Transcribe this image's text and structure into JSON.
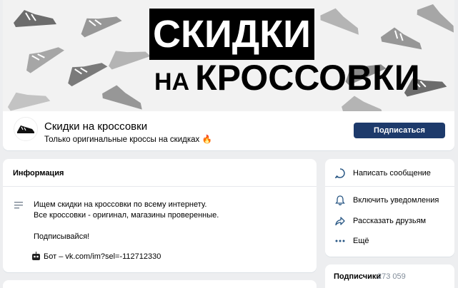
{
  "cover": {
    "line1": "СКИДКИ",
    "line2_small": "НА",
    "line2_big": "КРОССОВКИ"
  },
  "profile": {
    "name": "Скидки на кроссовки",
    "status": "Только оригинальные кроссы на скидках 🔥",
    "subscribe_label": "Подписаться"
  },
  "info": {
    "header": "Информация",
    "lines": [
      "Ищем скидки на кроссовки по всему интернету.",
      "Все кроссовки - оригинал, магазины проверенные.",
      "",
      "Подписывайся!"
    ],
    "bot": "Бот – vk.com/im?sel=-112712330"
  },
  "actions": {
    "message": "Написать сообщение",
    "notify": "Включить уведомления",
    "share": "Рассказать друзьям",
    "more": "Ещё"
  },
  "subscribers": {
    "label": "Подписчики",
    "count": "273 059"
  },
  "colors": {
    "accent": "#1d3a6b",
    "icon_blue": "#2a5885",
    "background": "#edeef0"
  }
}
